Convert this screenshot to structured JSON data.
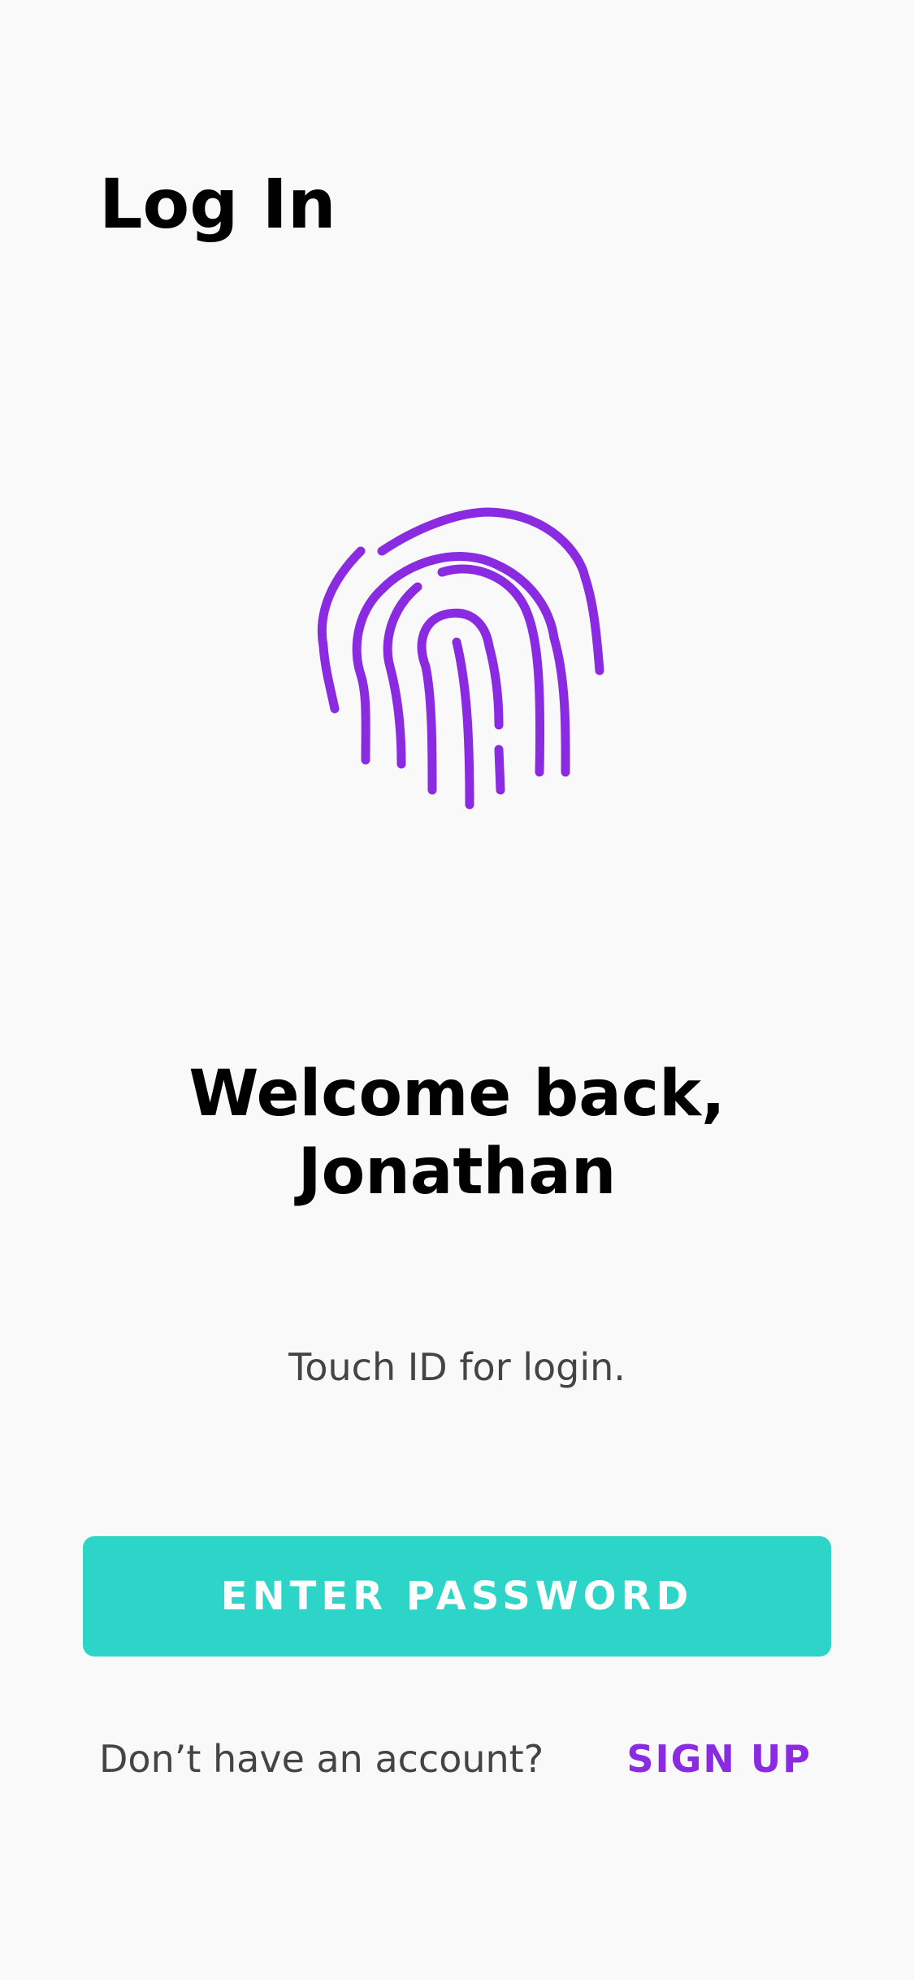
{
  "header": {
    "title": "Log In"
  },
  "fingerprint": {
    "icon": "fingerprint-icon"
  },
  "welcome": {
    "line1": "Welcome back,",
    "line2": "Jonathan"
  },
  "touch_id": {
    "text": "Touch ID for login."
  },
  "primary_button": {
    "label": "ENTER PASSWORD"
  },
  "footer": {
    "prompt": "Don’t have an account?",
    "signup_label": "SIGN UP"
  },
  "colors": {
    "background": "#f9f9f9",
    "accent_purple": "#8a2be2",
    "button_teal": "#2dd4c8",
    "title_text": "#000000",
    "body_text": "#444444"
  }
}
